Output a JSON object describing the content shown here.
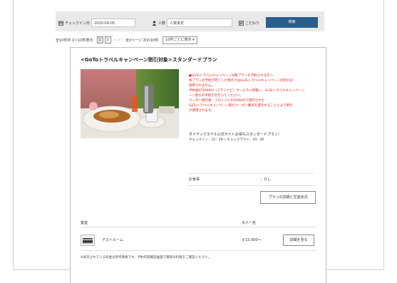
{
  "search": {
    "checkin_label": "チェックイン日",
    "checkin_value": "2020-09-05",
    "guests_label": "人数",
    "guests_value": "人数未定",
    "preferences_label": "こだわり",
    "search_button": "検索"
  },
  "pager": {
    "summary": "全10件中 1〜10件表示",
    "pages": [
      "1",
      "2"
    ],
    "rest": "・・・ 全2ページ 次の10件",
    "per_page": "10件ごとに表示"
  },
  "plan": {
    "title": "<GoToトラベルキャンペーン割引対象>スタンダードプラン",
    "notice_lines": [
      "●GoToトラベルキャンペーン対象プランを予約される方へ",
      "本プランの予約が完了した時点ではGoToトラベルキャンペーンの割引は",
      "適用されません。",
      "予約後STAYNAVI（ステイナビ）サービスに移動し、GoToトラベルキャンペーン",
      "ーン割引の手続きを行ってください。",
      "クーポン発行後、フロントにSTAYNAVIで発行された",
      "GoToトラベルキャンペーン割引クーポン番号を提示することにより割引",
      "が適用されます。"
    ],
    "description": "ダイテックホテル公式サイトお得なスタンダードプラン！",
    "times": "チェックイン：15：00〜 チェックアウト：10：00",
    "meal_label": "お食事",
    "meal_value": "：なし",
    "detail_button": "プランの詳細と空室状況"
  },
  "room": {
    "header_room": "客室",
    "header_price": "大人一名",
    "name": "テストルーム",
    "price": "￥15,000〜",
    "detail_button": "詳細を見る"
  },
  "footnote": "※表示されている料金は参考価格です。予約内容確認画面で最新の料金をご確認ください。"
}
